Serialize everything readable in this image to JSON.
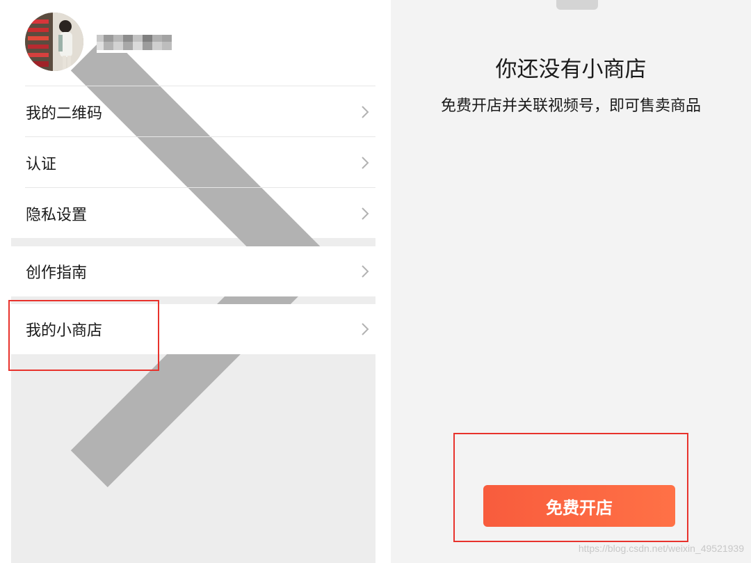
{
  "left": {
    "profile": {
      "username": "",
      "avatar_alt": "avatar"
    },
    "menu_group_1": [
      {
        "label": "我的二维码"
      },
      {
        "label": "认证"
      },
      {
        "label": "隐私设置"
      }
    ],
    "menu_group_2": [
      {
        "label": "创作指南"
      }
    ],
    "menu_group_3": [
      {
        "label": "我的小商店"
      }
    ]
  },
  "right": {
    "empty_title": "你还没有小商店",
    "empty_subtitle": "免费开店并关联视频号，即可售卖商品",
    "open_button_label": "免费开店",
    "watermark": "https://blog.csdn.net/weixin_49521939"
  },
  "colors": {
    "accent": "#f85c3d",
    "annotation": "#e8322c",
    "left_bg": "#ededed",
    "right_bg": "#f3f3f3"
  },
  "icons": [
    "chevron-right-icon",
    "avatar-image"
  ]
}
